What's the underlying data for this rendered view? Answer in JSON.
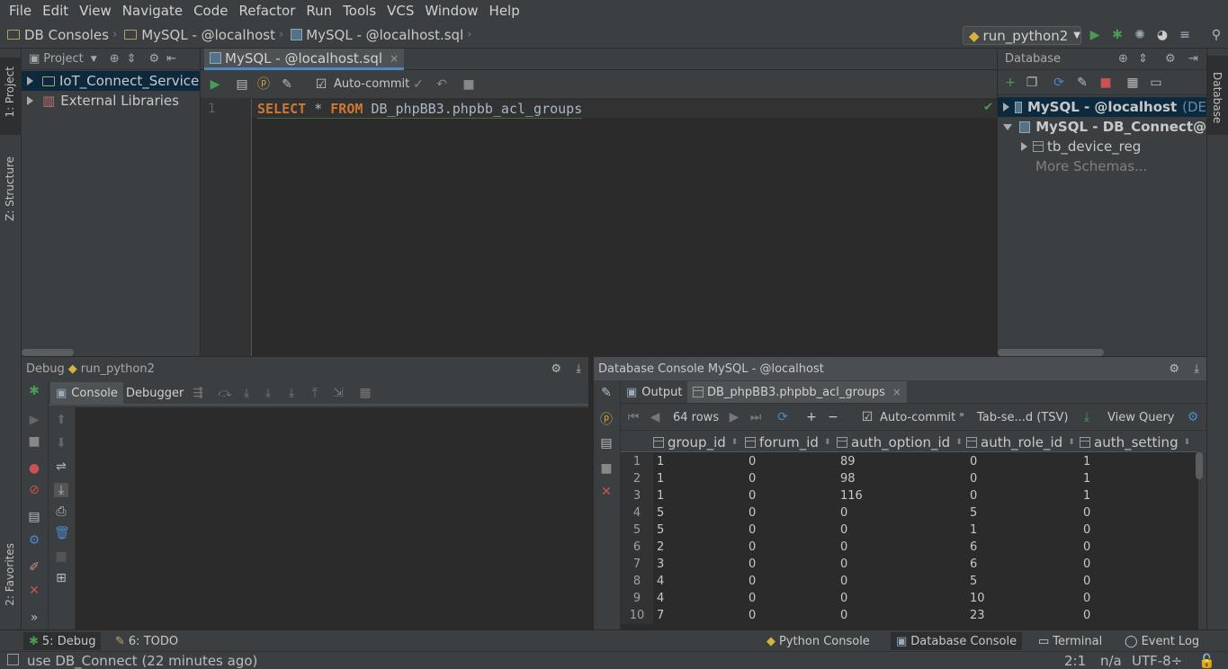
{
  "menu": [
    "File",
    "Edit",
    "View",
    "Navigate",
    "Code",
    "Refactor",
    "Run",
    "Tools",
    "VCS",
    "Window",
    "Help"
  ],
  "breadcrumbs": [
    "DB Consoles",
    "MySQL - @localhost",
    "MySQL - @localhost.sql"
  ],
  "run_config": "run_python2",
  "left_stripe": {
    "project": "1: Project",
    "structure": "Z: Structure",
    "favorites": "2: Favorites"
  },
  "project_panel": {
    "title": "Project",
    "items": [
      "IoT_Connect_Service",
      "External Libraries"
    ]
  },
  "editor": {
    "tab": "MySQL - @localhost.sql",
    "autocommit": "Auto-commit",
    "line_number": "1",
    "kw_select": "SELECT",
    "star": "*",
    "kw_from": "FROM",
    "table_ref": "DB_phpBB3.phpbb_acl_groups"
  },
  "database_panel": {
    "title": "Database",
    "items": [
      {
        "name": "MySQL - @localhost",
        "suffix": "(DE"
      },
      {
        "name": "MySQL - DB_Connect@"
      },
      {
        "name": "tb_device_reg"
      },
      {
        "name": "More Schemas..."
      }
    ]
  },
  "right_stripe": "Database",
  "debug": {
    "title": "Debug",
    "config": "run_python2",
    "tabs": [
      "Console",
      "Debugger"
    ]
  },
  "db_console": {
    "title": "Database Console MySQL - @localhost",
    "tabs": [
      "Output",
      "DB_phpBB3.phpbb_acl_groups"
    ],
    "rows_label": "64 rows",
    "autocommit": "Auto-commit",
    "format": "Tab-se...d (TSV)",
    "view_query": "View Query",
    "columns": [
      "group_id",
      "forum_id",
      "auth_option_id",
      "auth_role_id",
      "auth_setting"
    ],
    "rows": [
      [
        "1",
        "1",
        "0",
        "89",
        "0",
        "1"
      ],
      [
        "2",
        "1",
        "0",
        "98",
        "0",
        "1"
      ],
      [
        "3",
        "1",
        "0",
        "116",
        "0",
        "1"
      ],
      [
        "4",
        "5",
        "0",
        "0",
        "5",
        "0"
      ],
      [
        "5",
        "5",
        "0",
        "0",
        "1",
        "0"
      ],
      [
        "6",
        "2",
        "0",
        "0",
        "6",
        "0"
      ],
      [
        "7",
        "3",
        "0",
        "0",
        "6",
        "0"
      ],
      [
        "8",
        "4",
        "0",
        "0",
        "5",
        "0"
      ],
      [
        "9",
        "4",
        "0",
        "0",
        "10",
        "0"
      ],
      [
        "10",
        "7",
        "0",
        "0",
        "23",
        "0"
      ]
    ]
  },
  "bottom_tabs": {
    "debug": "5: Debug",
    "todo": "6: TODO",
    "python_console": "Python Console",
    "database_console": "Database Console",
    "terminal": "Terminal",
    "event_log": "Event Log"
  },
  "status": {
    "message": "use DB_Connect (22 minutes ago)",
    "position": "2:1",
    "line_sep": "n/a",
    "encoding": "UTF-8÷"
  }
}
